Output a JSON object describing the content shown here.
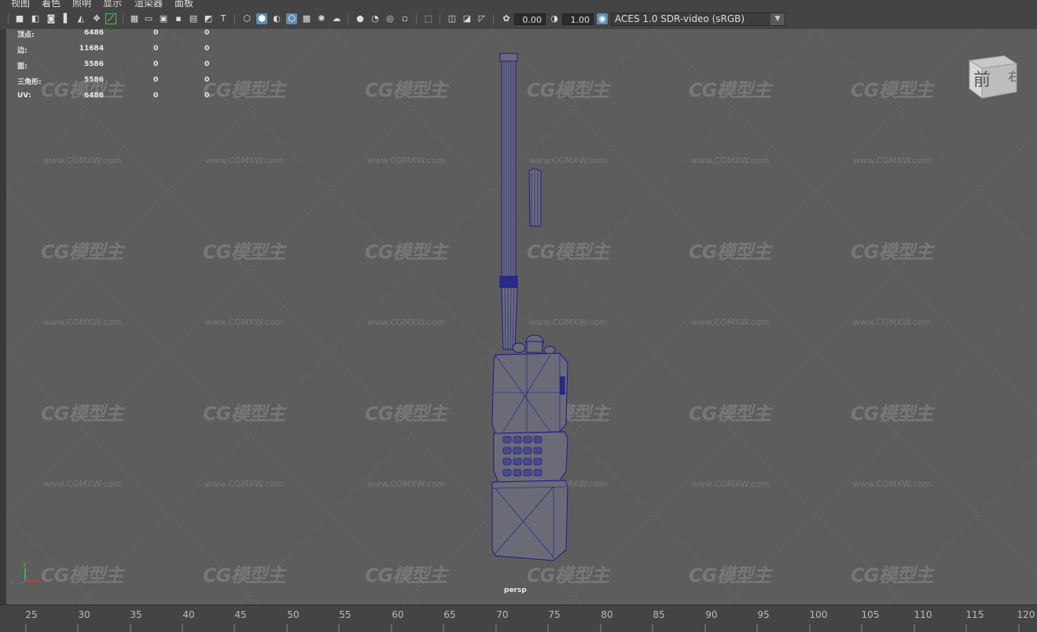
{
  "menubar": {
    "items": [
      "视图",
      "着色",
      "照明",
      "显示",
      "渲染器",
      "面板"
    ]
  },
  "toolbar": {
    "icons": [
      "camera-select-icon",
      "camera-attributes-icon",
      "bookmark-icon",
      "image-plane-icon",
      "grease-pencil-icon",
      "2d-pan-icon",
      "grid-icon",
      "film-gate-icon",
      "resolution-gate-icon",
      "gate-mask-icon",
      "field-chart-icon",
      "safe-action-icon",
      "safe-title-icon",
      "wireframe-icon",
      "smooth-shade-icon",
      "default-material-icon",
      "wireframe-on-shaded-icon",
      "textured-icon",
      "use-all-lights-icon",
      "shadows-icon",
      "screen-space-ao-icon",
      "motion-blur-icon",
      "multisample-aa-icon",
      "depth-of-field-icon",
      "isolate-select-icon",
      "xray-icon",
      "xray-active-components-icon",
      "xray-joints-icon"
    ],
    "exposure_value": "0.00",
    "gamma_value": "1.00",
    "color_space": "ACES 1.0 SDR-video (sRGB)"
  },
  "hud": {
    "rows": [
      {
        "label": "顶点:",
        "v1": "6486",
        "v2": "0",
        "v3": "0"
      },
      {
        "label": "边:",
        "v1": "11684",
        "v2": "0",
        "v3": "0"
      },
      {
        "label": "面:",
        "v1": "5586",
        "v2": "0",
        "v3": "0"
      },
      {
        "label": "三角形:",
        "v1": "5586",
        "v2": "0",
        "v3": "0"
      },
      {
        "label": "UV:",
        "v1": "6486",
        "v2": "0",
        "v3": "0"
      }
    ]
  },
  "watermark": {
    "logo": "CG模型主",
    "url": "www.CGMXW.com"
  },
  "viewcube": {
    "front": "前",
    "right": "右"
  },
  "axis": {
    "y": "y",
    "x": "x",
    "z": "z"
  },
  "camera": "persp",
  "timeline": {
    "ticks": [
      "25",
      "30",
      "35",
      "40",
      "45",
      "50",
      "55",
      "60",
      "65",
      "70",
      "75",
      "80",
      "85",
      "90",
      "95",
      "100",
      "105",
      "110",
      "115",
      "120"
    ]
  },
  "colors": {
    "background": "#5d5d5d",
    "panel": "#444444",
    "wireframe": "#1a1a8c",
    "active_icon": "#5c8fb0"
  }
}
